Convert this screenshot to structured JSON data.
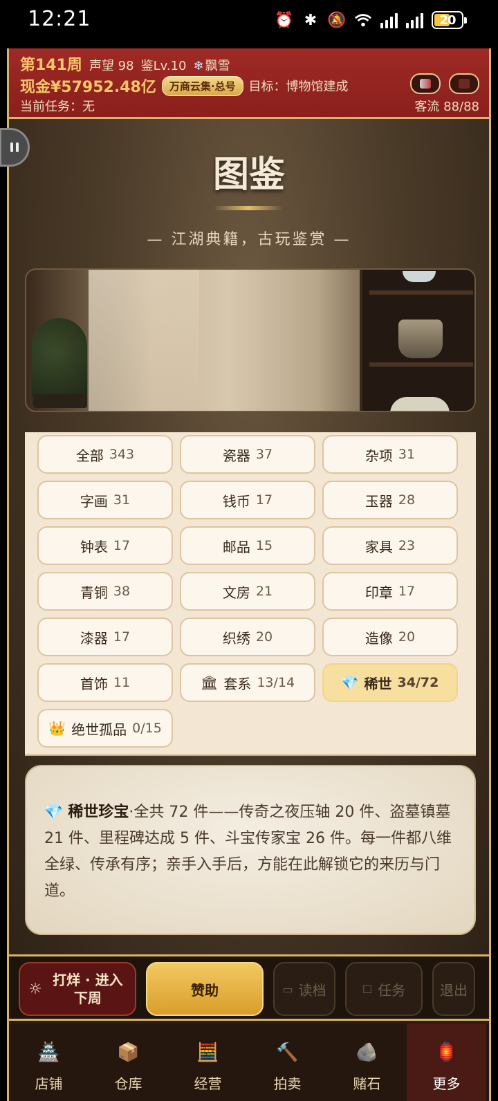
{
  "status_bar": {
    "time": "12:21",
    "battery": "20"
  },
  "header": {
    "week": "第141周",
    "fame": "声望 98",
    "appraisal_level": "鉴Lv.10",
    "weather": "飘雪",
    "cash": "现金¥57952.48亿",
    "shop_badge": "万商云集·总号",
    "goal": "目标：博物馆建成",
    "current_task": "当前任务：无",
    "guests": "客流 88/88"
  },
  "page": {
    "title": "图鉴",
    "subtitle": "— 江湖典籍，古玩鉴赏 —"
  },
  "categories": [
    {
      "label": "全部",
      "count": "343",
      "icon": ""
    },
    {
      "label": "瓷器",
      "count": "37",
      "icon": ""
    },
    {
      "label": "杂项",
      "count": "31",
      "icon": ""
    },
    {
      "label": "字画",
      "count": "31",
      "icon": ""
    },
    {
      "label": "钱币",
      "count": "17",
      "icon": ""
    },
    {
      "label": "玉器",
      "count": "28",
      "icon": ""
    },
    {
      "label": "钟表",
      "count": "17",
      "icon": ""
    },
    {
      "label": "邮品",
      "count": "15",
      "icon": ""
    },
    {
      "label": "家具",
      "count": "23",
      "icon": ""
    },
    {
      "label": "青铜",
      "count": "38",
      "icon": ""
    },
    {
      "label": "文房",
      "count": "21",
      "icon": ""
    },
    {
      "label": "印章",
      "count": "17",
      "icon": ""
    },
    {
      "label": "漆器",
      "count": "17",
      "icon": ""
    },
    {
      "label": "织绣",
      "count": "20",
      "icon": ""
    },
    {
      "label": "造像",
      "count": "20",
      "icon": ""
    },
    {
      "label": "首饰",
      "count": "11",
      "icon": ""
    },
    {
      "label": "套系",
      "count": "13/14",
      "icon": "🏛"
    },
    {
      "label": "稀世",
      "count": "34/72",
      "icon": "💎",
      "selected": true
    },
    {
      "label": "绝世孤品",
      "count": "0/15",
      "icon": "👑"
    }
  ],
  "description": {
    "icon": "💎",
    "title": "稀世珍宝",
    "text": "·全共 72 件——传奇之夜压轴 20 件、盗墓镇墓 21 件、里程碑达成 5 件、斗宝传家宝 26 件。每一件都八维全绿、传承有序；亲手入手后，方能在此解锁它的来历与门道。"
  },
  "actions": {
    "next_week": "打烊 · 进入下周",
    "sponsor": "赞助",
    "load": "读档",
    "task": "任务",
    "exit": "退出"
  },
  "nav": [
    {
      "label": "店铺",
      "icon": "shop-icon"
    },
    {
      "label": "仓库",
      "icon": "warehouse-icon"
    },
    {
      "label": "经营",
      "icon": "abacus-icon"
    },
    {
      "label": "拍卖",
      "icon": "gavel-icon"
    },
    {
      "label": "赌石",
      "icon": "jade-stone-icon"
    },
    {
      "label": "更多",
      "icon": "more-icon",
      "active": true
    }
  ]
}
